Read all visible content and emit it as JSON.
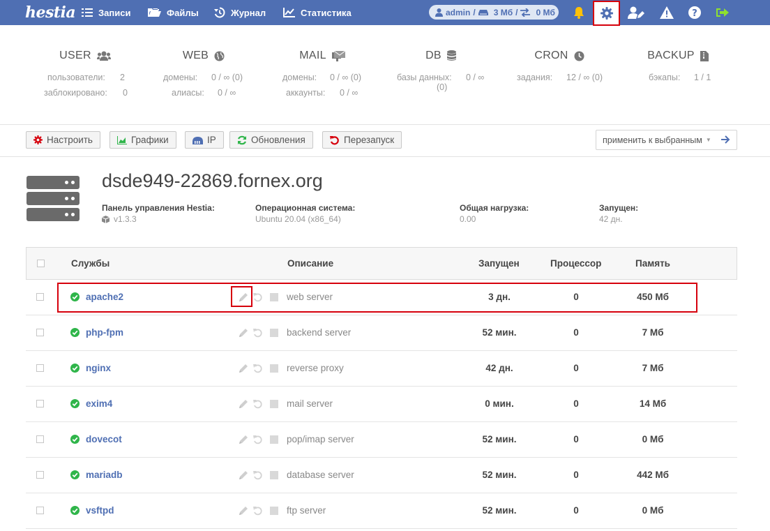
{
  "app": {
    "logo_text": "hestia"
  },
  "nav": [
    {
      "label": "Записи",
      "icon": "list-icon"
    },
    {
      "label": "Файлы",
      "icon": "folder-icon"
    },
    {
      "label": "Журнал",
      "icon": "history-icon"
    },
    {
      "label": "Статистика",
      "icon": "chart-icon"
    }
  ],
  "user_pill": {
    "user": "admin",
    "disk": "3 Мб",
    "bandwidth": "0 Мб",
    "separator": "/"
  },
  "top_icons": [
    "bell-icon",
    "gear-icon",
    "user-edit-icon",
    "warning-icon",
    "help-icon",
    "logout-icon"
  ],
  "stats": {
    "user": {
      "title": "USER",
      "row1_label": "пользователи:",
      "row1_value": "2",
      "row2_label": "заблокировано:",
      "row2_value": "0"
    },
    "web": {
      "title": "WEB",
      "row1_label": "домены:",
      "row1_value": "0 / ∞ (0)",
      "row2_label": "алиасы:",
      "row2_value": "0 / ∞"
    },
    "mail": {
      "title": "MAIL",
      "row1_label": "домены:",
      "row1_value": "0 / ∞ (0)",
      "row2_label": "аккаунты:",
      "row2_value": "0 / ∞"
    },
    "db": {
      "title": "DB",
      "row1_label": "базы данных:",
      "row1_value": "0 / ∞",
      "row1_extra": "(0)"
    },
    "cron": {
      "title": "CRON",
      "row1_label": "задания:",
      "row1_value": "12 / ∞ (0)"
    },
    "backup": {
      "title": "BACKUP",
      "row1_label": "бэкапы:",
      "row1_value": "1 / 1"
    }
  },
  "toolbar": {
    "configure": "Настроить",
    "graphs": "Графики",
    "ip": "IP",
    "updates": "Обновления",
    "restart": "Перезапуск",
    "apply_selected": "применить к выбранным"
  },
  "server": {
    "hostname": "dsde949-22869.fornex.org",
    "panel_label": "Панель управления Hestia:",
    "panel_value": "v1.3.3",
    "os_label": "Операционная система:",
    "os_value": "Ubuntu 20.04 (x86_64)",
    "load_label": "Общая нагрузка:",
    "load_value": "0.00",
    "uptime_label": "Запущен:",
    "uptime_value": "42 дн."
  },
  "table": {
    "headers": {
      "services": "Службы",
      "description": "Описание",
      "uptime": "Запущен",
      "cpu": "Процессор",
      "memory": "Память"
    },
    "rows": [
      {
        "name": "apache2",
        "description": "web server",
        "uptime": "3 дн.",
        "cpu": "0",
        "memory": "450 Мб"
      },
      {
        "name": "php-fpm",
        "description": "backend server",
        "uptime": "52 мин.",
        "cpu": "0",
        "memory": "7 Мб"
      },
      {
        "name": "nginx",
        "description": "reverse proxy",
        "uptime": "42 дн.",
        "cpu": "0",
        "memory": "7 Мб"
      },
      {
        "name": "exim4",
        "description": "mail server",
        "uptime": "0 мин.",
        "cpu": "0",
        "memory": "14 Мб"
      },
      {
        "name": "dovecot",
        "description": "pop/imap server",
        "uptime": "52 мин.",
        "cpu": "0",
        "memory": "0 Мб"
      },
      {
        "name": "mariadb",
        "description": "database server",
        "uptime": "52 мин.",
        "cpu": "0",
        "memory": "442 Мб"
      },
      {
        "name": "vsftpd",
        "description": "ftp server",
        "uptime": "52 мин.",
        "cpu": "0",
        "memory": "0 Мб"
      }
    ]
  },
  "colors": {
    "topbar": "#4f6fb3",
    "accent_red": "#d6000c",
    "status_green": "#2fb54a",
    "bell_yellow": "#ffc107"
  }
}
